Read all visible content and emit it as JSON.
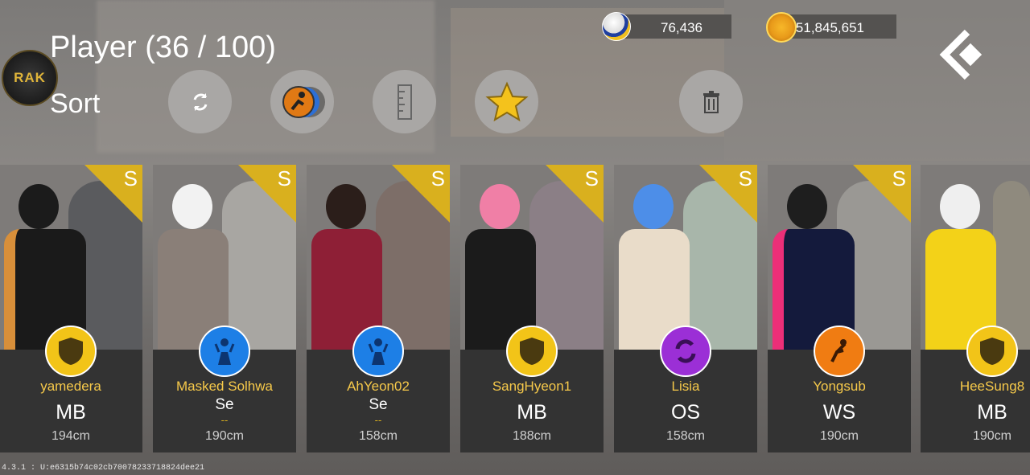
{
  "header": {
    "title": "Player (36 / 100)",
    "sort_label": "Sort",
    "logo_text": "RAK"
  },
  "sort_buttons": [
    {
      "name": "refresh-icon"
    },
    {
      "name": "position-filter-icon"
    },
    {
      "name": "ruler-icon"
    },
    {
      "name": "star-icon"
    },
    {
      "name": "trash-icon"
    }
  ],
  "currencies": [
    {
      "icon": "volleyball-icon",
      "value": "76,436"
    },
    {
      "icon": "gold-coin-icon",
      "value": "51,845,651"
    }
  ],
  "players": [
    {
      "name": "yamedera",
      "pos": "MB",
      "sub": "",
      "height": "194cm",
      "rank": "S",
      "badge": "shield-icon",
      "badge_color": "#f2c418"
    },
    {
      "name": "Masked Solhwa",
      "pos": "Se",
      "sub": "--",
      "height": "190cm",
      "rank": "S",
      "badge": "setter-icon",
      "badge_color": "#1d7fe6"
    },
    {
      "name": "AhYeon02",
      "pos": "Se",
      "sub": "--",
      "height": "158cm",
      "rank": "S",
      "badge": "setter-icon",
      "badge_color": "#1d7fe6"
    },
    {
      "name": "SangHyeon1",
      "pos": "MB",
      "sub": "",
      "height": "188cm",
      "rank": "S",
      "badge": "shield-icon",
      "badge_color": "#f2c418"
    },
    {
      "name": "Lisia",
      "pos": "OS",
      "sub": "",
      "height": "158cm",
      "rank": "S",
      "badge": "swap-icon",
      "badge_color": "#9b2fd6"
    },
    {
      "name": "Yongsub",
      "pos": "WS",
      "sub": "",
      "height": "190cm",
      "rank": "S",
      "badge": "spiker-icon",
      "badge_color": "#f07c12"
    },
    {
      "name": "HeeSung8",
      "pos": "MB",
      "sub": "",
      "height": "190cm",
      "rank": "S",
      "badge": "shield-icon",
      "badge_color": "#f2c418"
    }
  ],
  "version": "4.3.1 : U:e6315b74c02cb70078233718824dee21"
}
